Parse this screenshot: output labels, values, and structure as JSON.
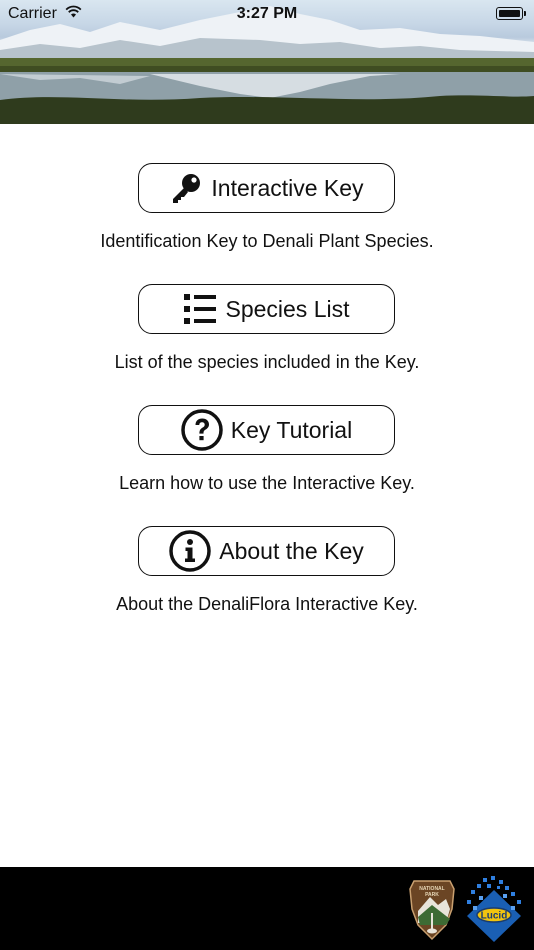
{
  "status_bar": {
    "carrier": "Carrier",
    "time": "3:27 PM",
    "battery_level": 1.0
  },
  "menu": {
    "items": [
      {
        "label": "Interactive Key",
        "icon": "key-icon",
        "description": "Identification Key to Denali Plant Species."
      },
      {
        "label": "Species List",
        "icon": "list-icon",
        "description": "List of the species included in the Key."
      },
      {
        "label": "Key Tutorial",
        "icon": "question-circle-icon",
        "description": "Learn how to use the Interactive Key."
      },
      {
        "label": "About the Key",
        "icon": "info-circle-icon",
        "description": "About the DenaliFlora Interactive Key."
      }
    ]
  },
  "footer": {
    "logos": [
      "national-park-service-logo",
      "lucid-logo"
    ],
    "nps_logo_text": "NATIONAL PARK SERVICE",
    "lucid_logo_text": "Lucid"
  },
  "colors": {
    "background": "#ffffff",
    "footer": "#000000",
    "button_border": "#111111"
  }
}
